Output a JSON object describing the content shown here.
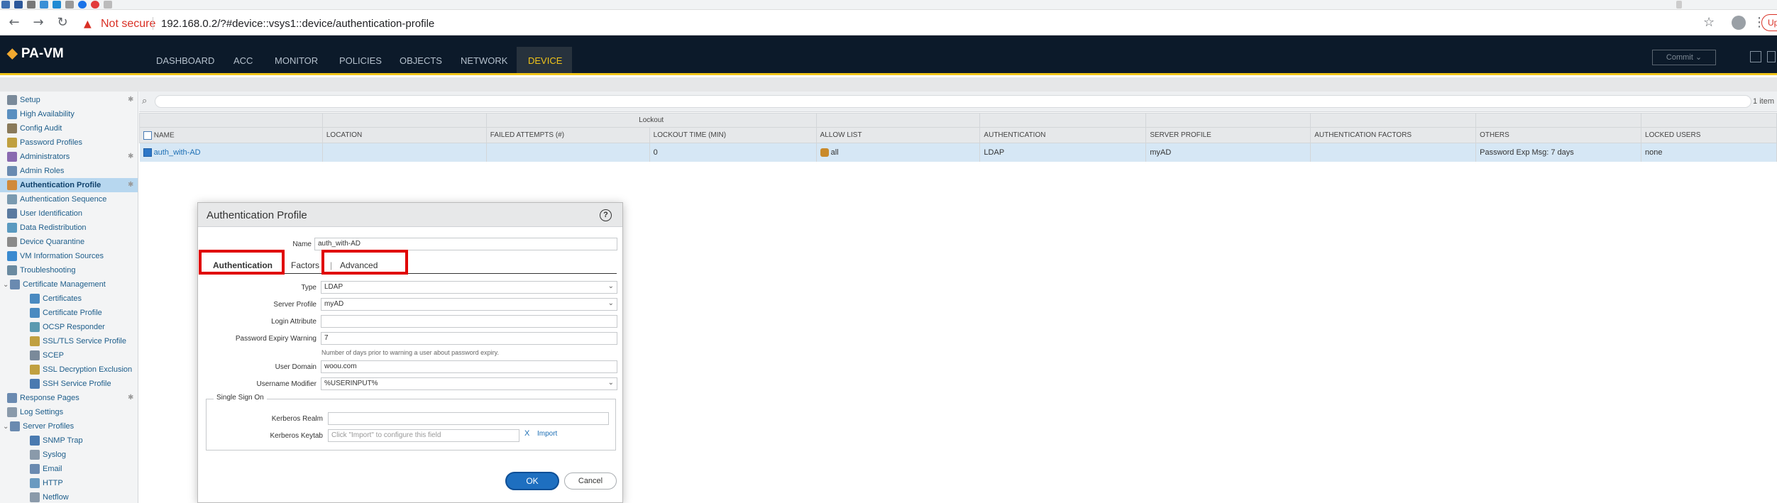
{
  "browser": {
    "not_secure": "Not secure",
    "url": "192.168.0.2/?#device::vsys1::device/authentication-profile",
    "update_label": "Upd"
  },
  "app": {
    "logo_mark": "◆",
    "logo": "PA-VM",
    "tabs": [
      "DASHBOARD",
      "ACC",
      "MONITOR",
      "POLICIES",
      "OBJECTS",
      "NETWORK",
      "DEVICE"
    ],
    "active_tab": "DEVICE",
    "commit_label": "Commit ⌄"
  },
  "sidebar": {
    "items": [
      {
        "label": "Setup",
        "star": "✱"
      },
      {
        "label": "High Availability"
      },
      {
        "label": "Config Audit"
      },
      {
        "label": "Password Profiles"
      },
      {
        "label": "Administrators",
        "star": "✱"
      },
      {
        "label": "Admin Roles"
      },
      {
        "label": "Authentication Profile",
        "star": "✱"
      },
      {
        "label": "Authentication Sequence"
      },
      {
        "label": "User Identification"
      },
      {
        "label": "Data Redistribution"
      },
      {
        "label": "Device Quarantine"
      },
      {
        "label": "VM Information Sources"
      },
      {
        "label": "Troubleshooting"
      },
      {
        "label": "Certificate Management"
      },
      {
        "label": "Certificates"
      },
      {
        "label": "Certificate Profile"
      },
      {
        "label": "OCSP Responder"
      },
      {
        "label": "SSL/TLS Service Profile"
      },
      {
        "label": "SCEP"
      },
      {
        "label": "SSL Decryption Exclusion"
      },
      {
        "label": "SSH Service Profile"
      },
      {
        "label": "Response Pages",
        "star": "✱"
      },
      {
        "label": "Log Settings"
      },
      {
        "label": "Server Profiles"
      },
      {
        "label": "SNMP Trap"
      },
      {
        "label": "Syslog"
      },
      {
        "label": "Email"
      },
      {
        "label": "HTTP"
      },
      {
        "label": "Netflow"
      }
    ],
    "expander": "⌄"
  },
  "grid": {
    "item_count": "1 item",
    "group_header": "Lockout",
    "columns": [
      "NAME",
      "LOCATION",
      "FAILED ATTEMPTS (#)",
      "LOCKOUT TIME (MIN)",
      "ALLOW LIST",
      "AUTHENTICATION",
      "SERVER PROFILE",
      "AUTHENTICATION FACTORS",
      "OTHERS",
      "LOCKED USERS"
    ],
    "row": {
      "name": "auth_with-AD",
      "location": "",
      "failed_attempts": "",
      "lockout_time": "0",
      "allow_list": "all",
      "authentication": "LDAP",
      "server_profile": "myAD",
      "authentication_factors": "",
      "others": "Password Exp Msg: 7 days",
      "locked_users": "none"
    }
  },
  "dialog": {
    "title": "Authentication Profile",
    "help": "?",
    "name_label": "Name",
    "name_value": "auth_with-AD",
    "tabs": {
      "authentication": "Authentication",
      "factors": "Factors",
      "advanced": "Advanced"
    },
    "type_label": "Type",
    "type_value": "LDAP",
    "server_profile_label": "Server Profile",
    "server_profile_value": "myAD",
    "login_attribute_label": "Login Attribute",
    "login_attribute_value": "",
    "pwd_expiry_label": "Password Expiry Warning",
    "pwd_expiry_value": "7",
    "pwd_expiry_hint": "Number of days prior to warning a user about password expiry.",
    "user_domain_label": "User Domain",
    "user_domain_value": "woou.com",
    "username_modifier_label": "Username Modifier",
    "username_modifier_value": "%USERINPUT%",
    "sso_title": "Single Sign On",
    "kerberos_realm_label": "Kerberos Realm",
    "kerberos_realm_value": "",
    "kerberos_keytab_label": "Kerberos Keytab",
    "kerberos_keytab_placeholder": "Click \"Import\" to configure this field",
    "import_x": "X",
    "import_label": "Import",
    "ok_label": "OK",
    "cancel_label": "Cancel"
  },
  "colors": {
    "highlight_box": "#e00000",
    "accent": "#f0c419",
    "header_bg": "#0c1a2a"
  }
}
